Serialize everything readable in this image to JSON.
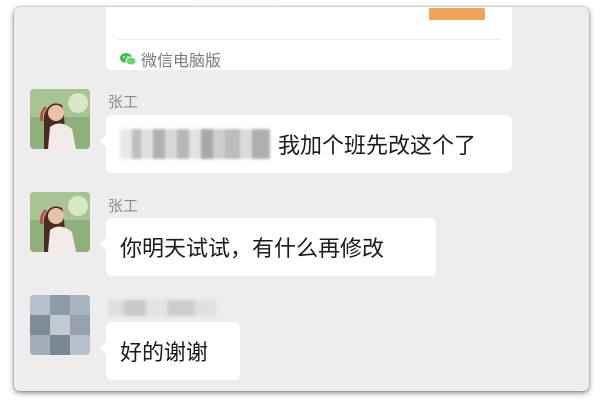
{
  "top_card": {
    "footer_text": "微信电脑版",
    "footer_icon": "wechat-icon",
    "accent_color": "#f0a35a"
  },
  "messages": [
    {
      "sender": "张工",
      "avatar": "avatar-girl-photo",
      "text": "我加个班先改这个了",
      "has_redacted_prefix": true
    },
    {
      "sender": "张工",
      "avatar": "avatar-girl-photo",
      "text": "你明天试试，有什么再修改"
    },
    {
      "sender": "",
      "avatar": "avatar-pixelated",
      "text": "好的谢谢",
      "sender_redacted": true
    }
  ]
}
